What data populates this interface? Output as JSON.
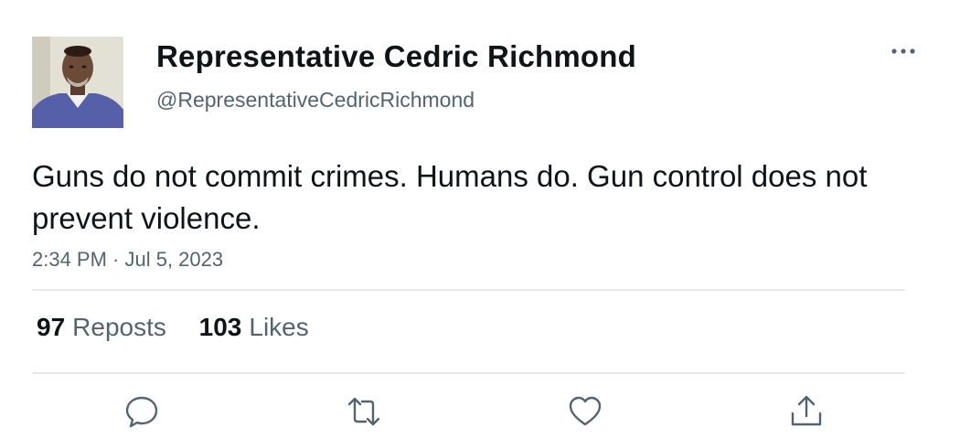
{
  "tweet": {
    "author": {
      "display_name": "Representative Cedric Richmond",
      "handle": "@RepresentativeCedricRichmond",
      "avatar_icon": "profile-photo"
    },
    "more_icon": "ellipsis-icon",
    "text": "Guns do not commit crimes. Humans do. Gun control does not prevent violence.",
    "timestamp": "2:34 PM · Jul 5, 2023",
    "stats": {
      "reposts_count": "97",
      "reposts_label": "Reposts",
      "likes_count": "103",
      "likes_label": "Likes"
    },
    "actions": [
      "reply-icon",
      "repost-icon",
      "like-icon",
      "share-icon"
    ]
  },
  "colors": {
    "text_primary": "#0f1419",
    "text_secondary": "#536471",
    "divider": "#e6e8ea",
    "icon": "#536471"
  }
}
